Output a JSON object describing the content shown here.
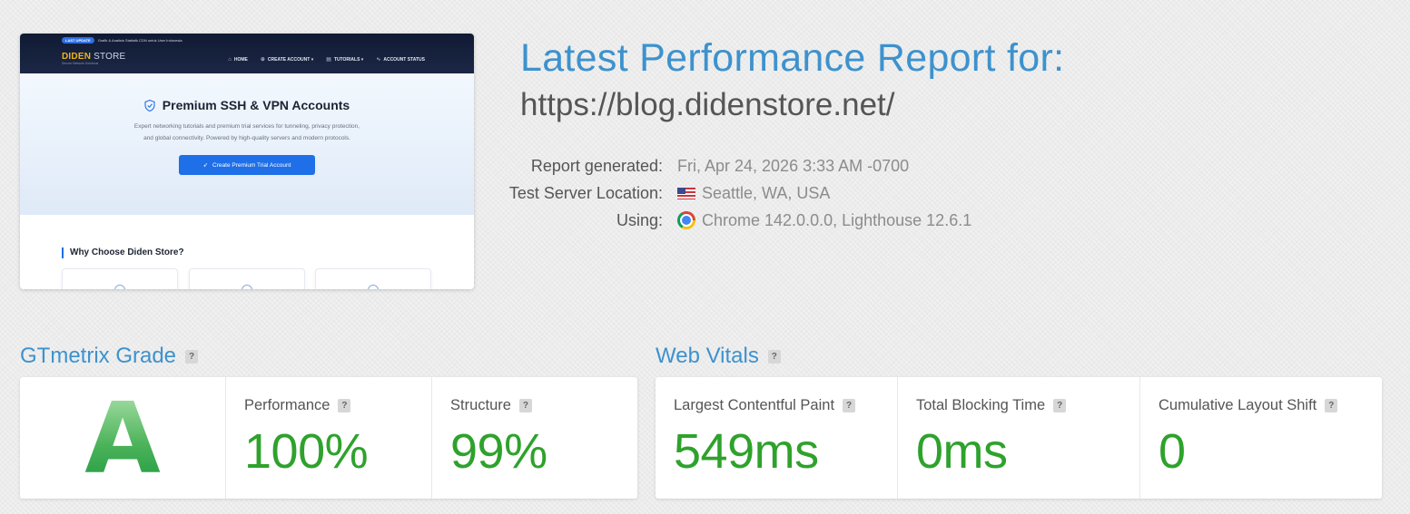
{
  "thumbnail": {
    "announce_pill": "LAST UPDATE",
    "announce_text": "Grafik & Analisis Statistik CDN untuk User Indonesia",
    "logo_main": "DIDEN",
    "logo_accent": "STORE",
    "logo_sub": "Secure Network Solutions",
    "nav": [
      {
        "label": "HOME",
        "icon": "home-icon"
      },
      {
        "label": "CREATE ACCOUNT ▾",
        "icon": "plus-circle-icon"
      },
      {
        "label": "TUTORIALS ▾",
        "icon": "book-icon"
      },
      {
        "label": "ACCOUNT STATUS",
        "icon": "pulse-icon"
      }
    ],
    "hero_title": "Premium SSH & VPN Accounts",
    "hero_desc": "Expert networking tutorials and premium trial services for tunneling, privacy protection, and global connectivity. Powered by high-quality servers and modern protocols.",
    "hero_button": "Create Premium Trial Account",
    "why_title": "Why Choose Diden Store?"
  },
  "report": {
    "title": "Latest Performance Report for:",
    "url": "https://blog.didenstore.net/",
    "generated_label": "Report generated:",
    "generated_value": "Fri, Apr 24, 2026 3:33 AM -0700",
    "location_label": "Test Server Location:",
    "location_value": "Seattle, WA, USA",
    "location_icon": "us-flag-icon",
    "using_label": "Using:",
    "using_value": "Chrome 142.0.0.0, Lighthouse 12.6.1",
    "using_icon": "chrome-icon"
  },
  "grade": {
    "title": "GTmetrix Grade",
    "help": "?",
    "letter": "A",
    "performance_label": "Performance",
    "performance_value": "100%",
    "structure_label": "Structure",
    "structure_value": "99%"
  },
  "vitals": {
    "title": "Web Vitals",
    "help": "?",
    "lcp_label": "Largest Contentful Paint",
    "lcp_value": "549ms",
    "tbt_label": "Total Blocking Time",
    "tbt_value": "0ms",
    "cls_label": "Cumulative Layout Shift",
    "cls_value": "0"
  },
  "colors": {
    "accent": "#3d92cd",
    "good": "#2ea22c"
  }
}
